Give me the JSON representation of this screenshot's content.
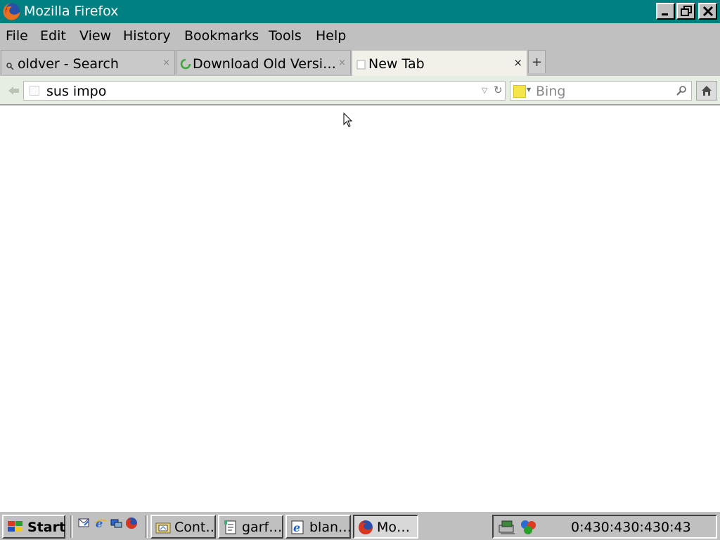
{
  "window": {
    "title": "Mozilla Firefox"
  },
  "menu": [
    {
      "label": "File"
    },
    {
      "label": "Edit"
    },
    {
      "label": "View"
    },
    {
      "label": "History"
    },
    {
      "label": "Bookmarks"
    },
    {
      "label": "Tools"
    },
    {
      "label": "Help"
    }
  ],
  "tabs": [
    {
      "label": "oldver - Search",
      "icon": "search-icon",
      "active": false
    },
    {
      "label": "Download Old Versi…",
      "icon": "loading-spinner-icon",
      "active": false
    },
    {
      "label": "New Tab",
      "icon": "blank-page-icon",
      "active": true
    }
  ],
  "tab_close_symbol": "×",
  "new_tab_symbol": "+",
  "navbar": {
    "url": "sus impo",
    "search_placeholder": "Bing",
    "reload_symbol": "↻",
    "dropdown_symbol": "▽"
  },
  "taskbar": {
    "start_label": "Start",
    "quick_launch": [
      "outlook-express-icon",
      "internet-explorer-icon",
      "show-desktop-icon",
      "firefox-icon"
    ],
    "tasks": [
      {
        "label": "Cont…",
        "icon": "control-panel-icon",
        "active": false
      },
      {
        "label": "garf…",
        "icon": "notepad-icon",
        "active": false
      },
      {
        "label": "blan…",
        "icon": "internet-explorer-icon",
        "active": false
      },
      {
        "label": "Mo…",
        "icon": "firefox-icon",
        "active": true
      }
    ],
    "tray_icons": [
      "network-icon",
      "display-settings-icon"
    ],
    "clock": "0:430:430:430:43"
  },
  "colors": {
    "titlebar": "#008080",
    "chrome": "#c0c0c0",
    "navbar": "#e6ede2",
    "active_tab": "#f1f1ea"
  }
}
